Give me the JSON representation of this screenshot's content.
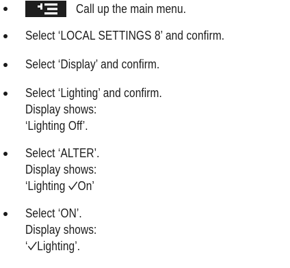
{
  "instructions": {
    "menu_key": {
      "icon": "menu-key-icon",
      "color": "#1e1e1e"
    },
    "step1": "Call up the main menu.",
    "step2": "Select ‘LOCAL SETTINGS 8’ and confirm.",
    "step3": "Select ‘Display’ and confirm.",
    "step4": "Select ‘Lighting’ and confirm.",
    "step4_display_label": "Display shows:",
    "step4_display_value": "‘Lighting Off’.",
    "step5": "Select ‘ALTER’.",
    "step5_display_label": "Display shows:",
    "step5_display_prefix": "‘Lighting ",
    "step5_display_suffix": "On’",
    "step6": "Select ‘ON’.",
    "step6_display_label": "Display shows:",
    "step6_display_prefix": "‘",
    "step6_display_suffix": "Lighting’."
  }
}
